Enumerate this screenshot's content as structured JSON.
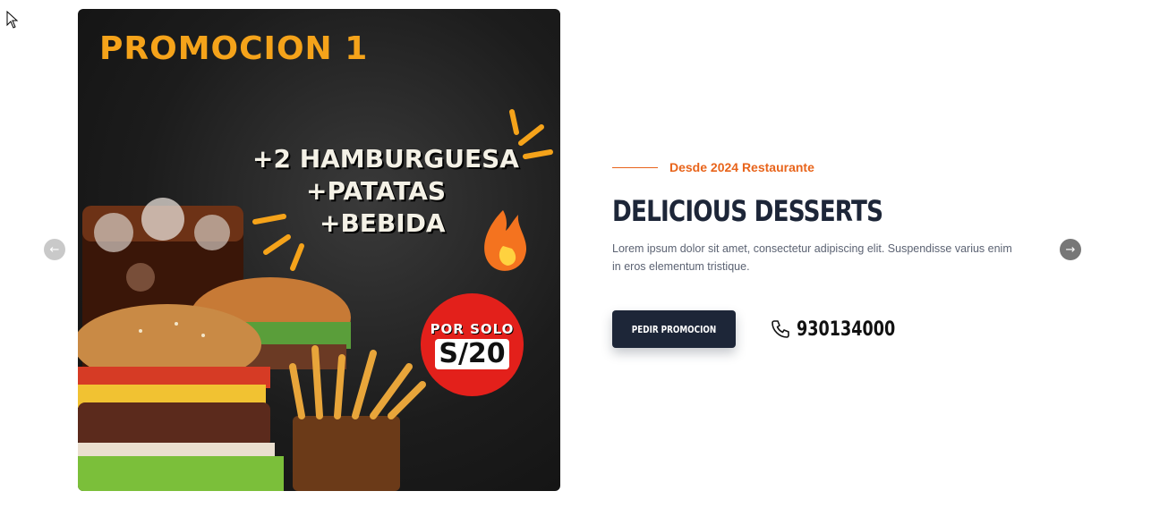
{
  "slide": {
    "promo_title": "PROMOCION 1",
    "promo_lines": [
      "+2 HAMBURGUESA",
      "+PATATAS",
      "+BEBIDA"
    ],
    "badge_top": "POR SOLO",
    "badge_price": "S/20"
  },
  "content": {
    "eyebrow": "Desde 2024 Restaurante",
    "heading": "DELICIOUS DESSERTS",
    "description": "Lorem ipsum dolor sit amet, consectetur adipiscing elit. Suspendisse varius enim in eros elementum tristique.",
    "cta_label": "PEDIR PROMOCION",
    "phone": "930134000"
  },
  "nav": {
    "prev_icon": "←",
    "next_icon": "→"
  },
  "colors": {
    "accent": "#e8641b",
    "dark": "#1d2638",
    "promo_yellow": "#f5a31a",
    "badge_red": "#e3201b"
  }
}
